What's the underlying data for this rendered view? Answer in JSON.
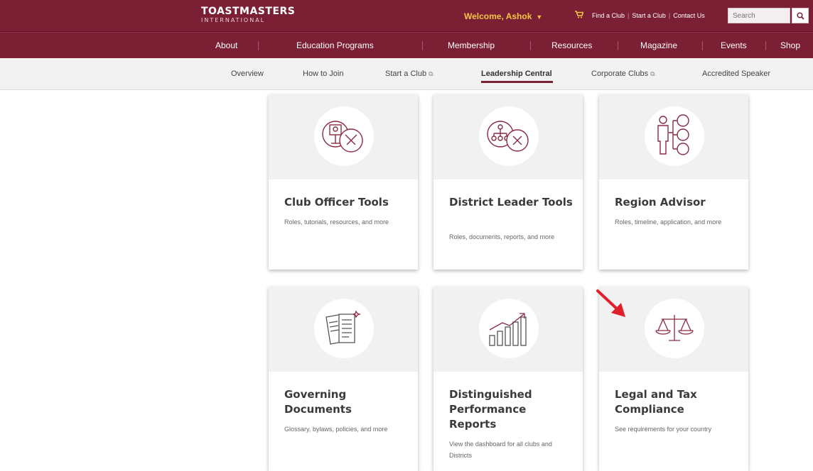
{
  "header": {
    "logo_line1": "TOASTMASTERS",
    "logo_line2": "INTERNATIONAL",
    "welcome": "Welcome, Ashok",
    "links": [
      "Find a Club",
      "Start a Club",
      "Contact Us"
    ],
    "search_placeholder": "Search",
    "brand_color": "#7b1f35",
    "accent_color": "#f5c542"
  },
  "main_nav": [
    "About",
    "Education Programs",
    "Membership",
    "Resources",
    "Magazine",
    "Events",
    "Shop"
  ],
  "sub_nav": {
    "items": [
      "Overview",
      "How to Join",
      "Start a Club",
      "Leadership Central",
      "Corporate Clubs",
      "Accredited Speaker"
    ],
    "active": "Leadership Central"
  },
  "cards": [
    {
      "title": "Club Officer Tools",
      "desc": "Roles, tutorials, resources, and more",
      "icon": "podium-tools-icon"
    },
    {
      "title": "District Leader Tools",
      "desc": "Roles, documents, reports, and more",
      "icon": "org-chart-tools-icon"
    },
    {
      "title": "Region Advisor",
      "desc": "Roles, timeline, application, and more",
      "icon": "advisor-icon"
    },
    {
      "title": "Governing Documents",
      "desc": "Glossary, bylaws, policies, and more",
      "icon": "documents-icon"
    },
    {
      "title": "Distinguished Performance Reports",
      "desc": "View the dashboard for all clubs and Districts",
      "icon": "growth-chart-icon"
    },
    {
      "title": "Legal and Tax Compliance",
      "desc": "See requirements for your country",
      "icon": "scales-icon"
    }
  ]
}
